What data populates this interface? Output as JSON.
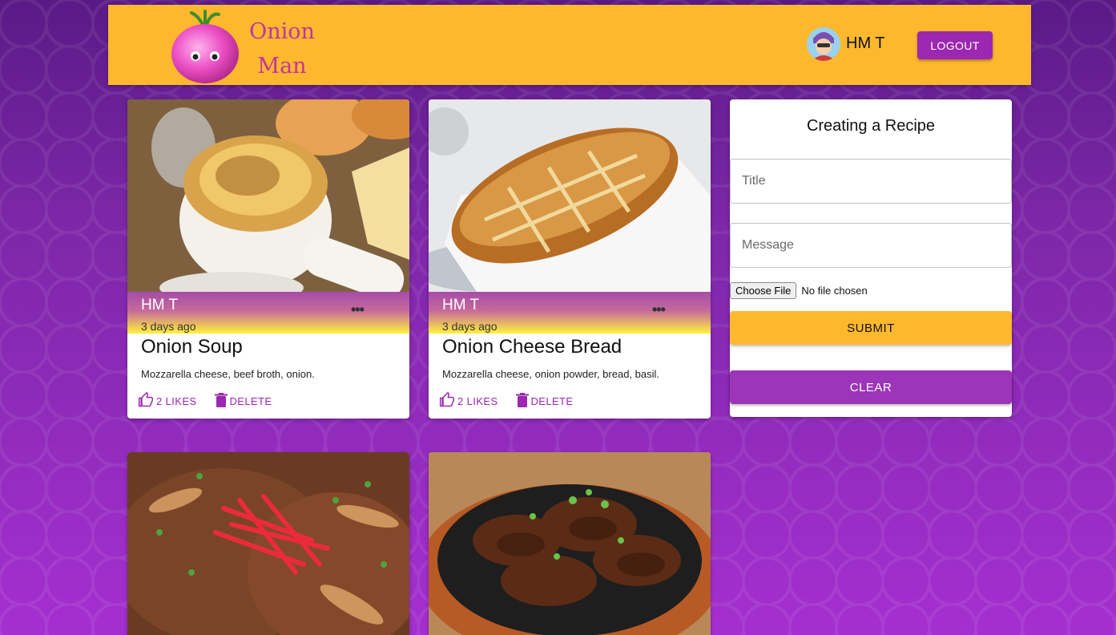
{
  "header": {
    "brand_line1": "Onion",
    "brand_line2": "Man",
    "username": "HM T",
    "logout_label": "LOGOUT"
  },
  "posts": [
    {
      "author": "HM T",
      "time": "3 days ago",
      "title": "Onion Soup",
      "message": "Mozzarella cheese, beef broth, onion.",
      "likes_label": "2 LIKES",
      "delete_label": "DELETE",
      "image_icon": "onion-soup-photo"
    },
    {
      "author": "HM T",
      "time": "3 days ago",
      "title": "Onion Cheese Bread",
      "message": "Mozzarella cheese, onion powder, bread, basil.",
      "likes_label": "2 LIKES",
      "delete_label": "DELETE",
      "image_icon": "cheese-bread-photo"
    },
    {
      "image_icon": "beef-bowl-photo"
    },
    {
      "image_icon": "galbi-sizzling-plate-photo"
    }
  ],
  "form": {
    "heading": "Creating a Recipe",
    "title_placeholder": "Title",
    "message_placeholder": "Message",
    "file_button": "Choose File",
    "file_status": "No file chosen",
    "submit_label": "SUBMIT",
    "clear_label": "CLEAR"
  },
  "colors": {
    "header_bg": "#fdb82e",
    "primary_purple": "#9c27b0",
    "brand_text": "#c0359f",
    "submit_bg": "#fdb82e"
  }
}
